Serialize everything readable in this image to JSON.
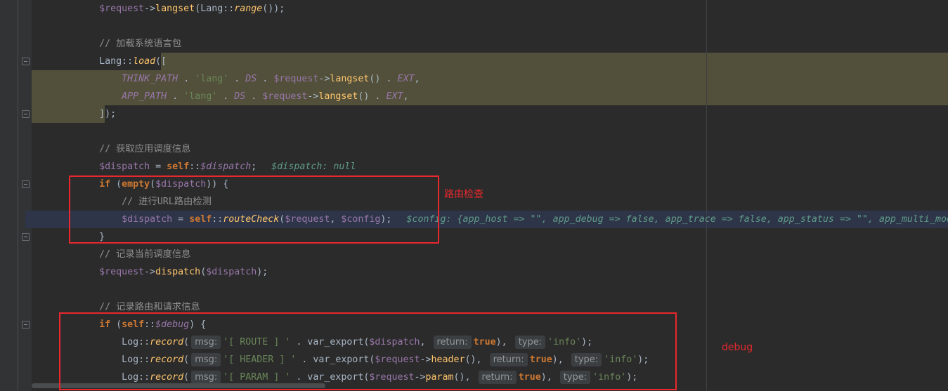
{
  "syntax_colors": {
    "plain": "#A9B7C6",
    "variable": "#9876AA",
    "static-var": "#9876AA",
    "method": "#FFC66D",
    "static-call": "#FFC66D",
    "keyword": "#CC7832",
    "constant": "#9876AA",
    "string": "#6A8759",
    "comment": "#8F8F8F",
    "inline-value": "#5F9C8A",
    "hint": "#959899"
  },
  "editor": {
    "lines": [
      [
        [
          "plain",
          "            "
        ],
        [
          "variable",
          "$request"
        ],
        [
          "plain",
          "->"
        ],
        [
          "method",
          "langset"
        ],
        [
          "plain",
          "(Lang::"
        ],
        [
          "static-call",
          "range"
        ],
        [
          "plain",
          "());"
        ]
      ],
      [],
      [
        [
          "comment",
          "            // 加载系统语言包"
        ]
      ],
      [
        [
          "plain",
          "            Lang::"
        ],
        [
          "static-call",
          "load"
        ],
        [
          "plain",
          "(["
        ]
      ],
      [
        [
          "plain",
          "                "
        ],
        [
          "constant",
          "THINK_PATH"
        ],
        [
          "plain",
          " . "
        ],
        [
          "string",
          "'lang'"
        ],
        [
          "plain",
          " . "
        ],
        [
          "constant",
          "DS"
        ],
        [
          "plain",
          " . "
        ],
        [
          "variable",
          "$request"
        ],
        [
          "plain",
          "->"
        ],
        [
          "method",
          "langset"
        ],
        [
          "plain",
          "() . "
        ],
        [
          "constant",
          "EXT"
        ],
        [
          "plain",
          ","
        ]
      ],
      [
        [
          "plain",
          "                "
        ],
        [
          "constant",
          "APP_PATH"
        ],
        [
          "plain",
          " . "
        ],
        [
          "string",
          "'lang'"
        ],
        [
          "plain",
          " . "
        ],
        [
          "constant",
          "DS"
        ],
        [
          "plain",
          " . "
        ],
        [
          "variable",
          "$request"
        ],
        [
          "plain",
          "->"
        ],
        [
          "method",
          "langset"
        ],
        [
          "plain",
          "() . "
        ],
        [
          "constant",
          "EXT"
        ],
        [
          "plain",
          ","
        ]
      ],
      [
        [
          "plain",
          "            ]);"
        ]
      ],
      [],
      [
        [
          "comment",
          "            // 获取应用调度信息"
        ]
      ],
      [
        [
          "plain",
          "            "
        ],
        [
          "variable",
          "$dispatch"
        ],
        [
          "plain",
          " = "
        ],
        [
          "keyword",
          "self"
        ],
        [
          "plain",
          "::"
        ],
        [
          "static-var",
          "$dispatch"
        ],
        [
          "plain",
          ";"
        ],
        [
          "inline-value",
          "$dispatch: null"
        ]
      ],
      [
        [
          "plain",
          "            "
        ],
        [
          "keyword",
          "if"
        ],
        [
          "plain",
          " ("
        ],
        [
          "keyword",
          "empty"
        ],
        [
          "plain",
          "("
        ],
        [
          "variable",
          "$dispatch"
        ],
        [
          "plain",
          ")) {"
        ]
      ],
      [
        [
          "comment",
          "                // 进行URL路由检测"
        ]
      ],
      [
        [
          "plain",
          "                "
        ],
        [
          "variable",
          "$dispatch"
        ],
        [
          "plain",
          " = "
        ],
        [
          "keyword",
          "self"
        ],
        [
          "plain",
          "::"
        ],
        [
          "static-call",
          "routeCheck"
        ],
        [
          "plain",
          "("
        ],
        [
          "variable",
          "$request"
        ],
        [
          "plain",
          ", "
        ],
        [
          "variable",
          "$config"
        ],
        [
          "plain",
          ");"
        ],
        [
          "inline-value",
          "$config: {app_host => \"\", app_debug => false, app_trace => false, app_status => \"\", app_multi_mod"
        ]
      ],
      [
        [
          "plain",
          "            }"
        ]
      ],
      [
        [
          "comment",
          "            // 记录当前调度信息"
        ]
      ],
      [
        [
          "plain",
          "            "
        ],
        [
          "variable",
          "$request"
        ],
        [
          "plain",
          "->"
        ],
        [
          "method",
          "dispatch"
        ],
        [
          "plain",
          "("
        ],
        [
          "variable",
          "$dispatch"
        ],
        [
          "plain",
          ");"
        ]
      ],
      [],
      [
        [
          "comment",
          "            // 记录路由和请求信息"
        ]
      ],
      [
        [
          "plain",
          "            "
        ],
        [
          "keyword",
          "if"
        ],
        [
          "plain",
          " ("
        ],
        [
          "keyword",
          "self"
        ],
        [
          "plain",
          "::"
        ],
        [
          "static-var",
          "$debug"
        ],
        [
          "plain",
          ") {"
        ]
      ],
      [
        [
          "plain",
          "                Log::"
        ],
        [
          "static-call",
          "record"
        ],
        [
          "plain",
          "("
        ],
        [
          "hint",
          "msg:"
        ],
        [
          "string",
          "'[ ROUTE ] '"
        ],
        [
          "plain",
          " . var_export("
        ],
        [
          "variable",
          "$dispatch"
        ],
        [
          "plain",
          ", "
        ],
        [
          "hint",
          "return:"
        ],
        [
          "keyword",
          "true"
        ],
        [
          "plain",
          "), "
        ],
        [
          "hint",
          "type:"
        ],
        [
          "string",
          "'info'"
        ],
        [
          "plain",
          ");"
        ]
      ],
      [
        [
          "plain",
          "                Log::"
        ],
        [
          "static-call",
          "record"
        ],
        [
          "plain",
          "("
        ],
        [
          "hint",
          "msg:"
        ],
        [
          "string",
          "'[ HEADER ] '"
        ],
        [
          "plain",
          " . var_export("
        ],
        [
          "variable",
          "$request"
        ],
        [
          "plain",
          "->"
        ],
        [
          "method",
          "header"
        ],
        [
          "plain",
          "(), "
        ],
        [
          "hint",
          "return:"
        ],
        [
          "keyword",
          "true"
        ],
        [
          "plain",
          "), "
        ],
        [
          "hint",
          "type:"
        ],
        [
          "string",
          "'info'"
        ],
        [
          "plain",
          ");"
        ]
      ],
      [
        [
          "plain",
          "                Log::"
        ],
        [
          "static-call",
          "record"
        ],
        [
          "plain",
          "("
        ],
        [
          "hint",
          "msg:"
        ],
        [
          "string",
          "'[ PARAM ] '"
        ],
        [
          "plain",
          " . var_export("
        ],
        [
          "variable",
          "$request"
        ],
        [
          "plain",
          "->"
        ],
        [
          "method",
          "param"
        ],
        [
          "plain",
          "(), "
        ],
        [
          "hint",
          "return:"
        ],
        [
          "keyword",
          "true"
        ],
        [
          "plain",
          "), "
        ],
        [
          "hint",
          "type:"
        ],
        [
          "string",
          "'info'"
        ],
        [
          "plain",
          ");"
        ]
      ]
    ]
  },
  "annotations": {
    "route_check_label": "路由检查",
    "debug_label": "debug",
    "color": "#E8282D"
  }
}
